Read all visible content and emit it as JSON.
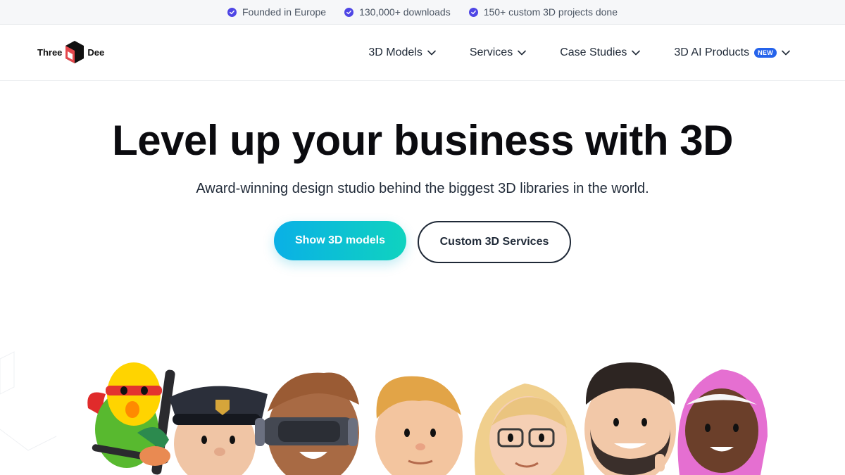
{
  "topbar": {
    "items": [
      {
        "label": "Founded in Europe",
        "icon": "check-circle-icon"
      },
      {
        "label": "130,000+ downloads",
        "icon": "check-circle-icon"
      },
      {
        "label": "150+ custom 3D projects done",
        "icon": "check-circle-icon"
      }
    ],
    "accent": "#4f46e5"
  },
  "logo": {
    "left": "Three",
    "right": "Dee"
  },
  "nav": {
    "items": [
      {
        "label": "3D Models",
        "icon": "chevron-down-icon"
      },
      {
        "label": "Services",
        "icon": "chevron-down-icon"
      },
      {
        "label": "Case Studies",
        "icon": "chevron-down-icon"
      },
      {
        "label": "3D AI Products",
        "badge": "NEW",
        "icon": "chevron-down-icon"
      }
    ]
  },
  "hero": {
    "title": "Level up your business with 3D",
    "subtitle": "Award-winning design studio behind the biggest 3D libraries in the world.",
    "primary_button": "Show 3D models",
    "secondary_button": "Custom 3D Services"
  },
  "colors": {
    "primary_gradient_start": "#0ab0e6",
    "primary_gradient_end": "#0fd3bf",
    "badge": "#2563eb",
    "text_dark": "#0b0b0f"
  },
  "characters": [
    "parrot-character",
    "police-officer-character",
    "vr-headset-character",
    "blond-boy-character",
    "glasses-woman-character",
    "bearded-man-character",
    "hijab-woman-character"
  ]
}
